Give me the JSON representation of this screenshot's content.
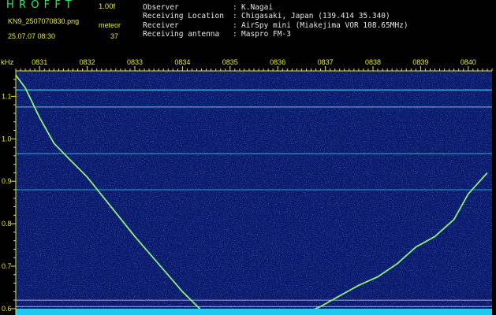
{
  "header": {
    "app_title": "HROFFT",
    "version": "1.00f",
    "file_name": "KN9_2507070830.png",
    "date_time": "25.07.07 08:30",
    "meteor_label": "meteor",
    "meteor_count": "37",
    "info": [
      {
        "key": "Observer",
        "sep": ":",
        "value": "K.Nagai"
      },
      {
        "key": "Receiving Location",
        "sep": ":",
        "value": "Chigasaki, Japan (139.414 35.340)"
      },
      {
        "key": "Receiver",
        "sep": ":",
        "value": "AirSpy mini (Miakejima VOR 108.65MHz)"
      },
      {
        "key": "Receiving antenna",
        "sep": ":",
        "value": "Maspro FM-3"
      }
    ]
  },
  "colors": {
    "title": "#2fe85a",
    "header_yellow": "#e8e832",
    "header_text": "#e6e6e6",
    "axis": "#e8e832",
    "background_noise": "#0a1a6e",
    "carrier": "#38c8e0",
    "trace": "#8cf07a",
    "bottom_band": "#1ec8f0"
  },
  "chart_data": {
    "type": "heatmap",
    "ylabel": "kHz",
    "x_ticks": [
      "0831",
      "0832",
      "0833",
      "0834",
      "0835",
      "0836",
      "0837",
      "0838",
      "0839",
      "0840"
    ],
    "x_range_min": [
      30.5,
      40.5
    ],
    "y_ticks": [
      "1.1",
      "1.0",
      "0.9",
      "0.8",
      "0.7",
      "0.6"
    ],
    "y_range_khz": [
      0.585,
      1.16
    ],
    "carrier_lines_khz": [
      1.115,
      1.075,
      0.965,
      0.88
    ],
    "frame_lines_khz": [
      0.62,
      0.605
    ],
    "decreasing_trace": {
      "x_min": [
        30.5,
        30.7,
        31.0,
        31.3,
        31.6,
        32.0,
        32.5,
        33.0,
        33.5,
        34.0,
        34.45
      ],
      "y_khz": [
        1.15,
        1.12,
        1.05,
        0.99,
        0.955,
        0.91,
        0.84,
        0.77,
        0.705,
        0.64,
        0.59
      ]
    },
    "increasing_trace": {
      "x_min": [
        36.5,
        36.9,
        37.3,
        37.7,
        38.1,
        38.5,
        38.9,
        39.3,
        39.7,
        40.0,
        40.4
      ],
      "y_khz": [
        0.585,
        0.605,
        0.63,
        0.655,
        0.675,
        0.705,
        0.745,
        0.77,
        0.81,
        0.87,
        0.92
      ]
    }
  }
}
